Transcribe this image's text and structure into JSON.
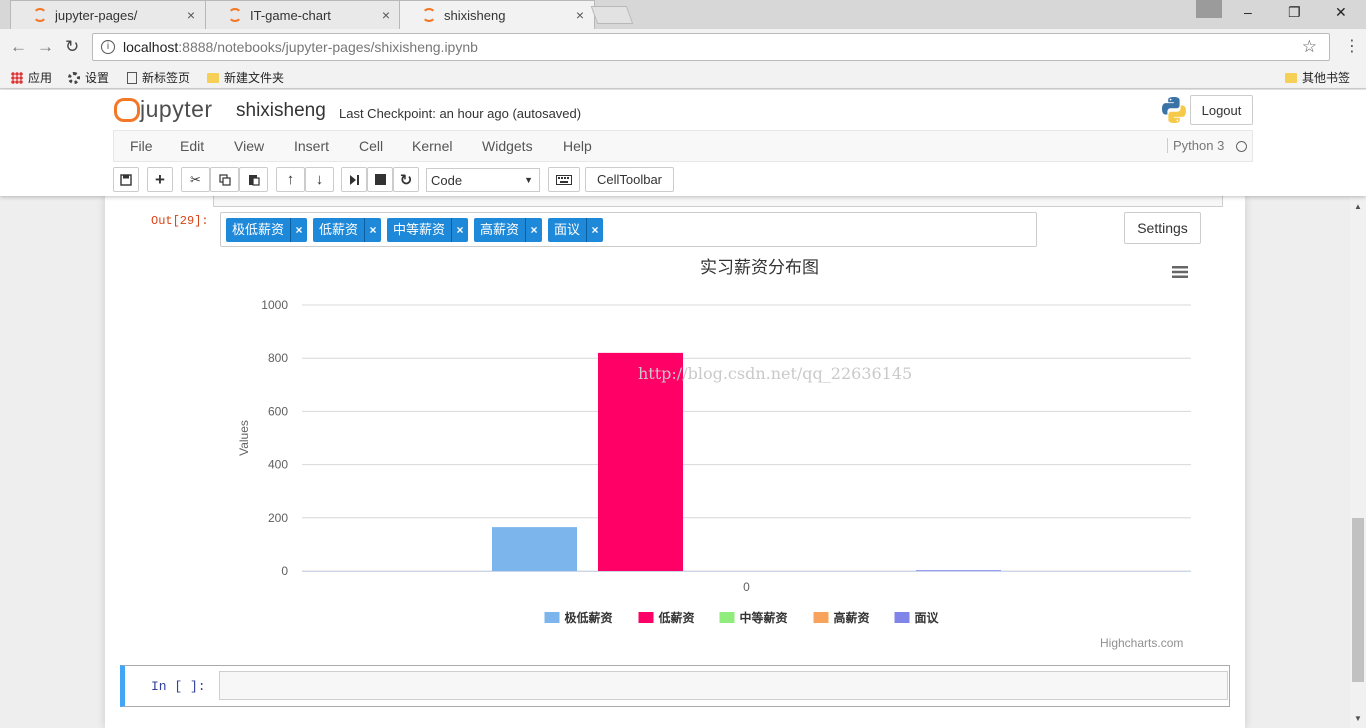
{
  "browser": {
    "tabs": [
      {
        "title": "jupyter-pages/",
        "close": "×"
      },
      {
        "title": "IT-game-chart",
        "close": "×"
      },
      {
        "title": "shixisheng",
        "close": "×"
      }
    ],
    "window_controls": [
      "–",
      "❐",
      "✕"
    ],
    "url_host": "localhost",
    "url_path": ":8888/notebooks/jupyter-pages/shixisheng.ipynb",
    "bookmarks": [
      "应用",
      "设置",
      "新标签页",
      "新建文件夹"
    ],
    "other_bookmarks": "其他书签"
  },
  "jupyter": {
    "logo_text": "jupyter",
    "notebook_name": "shixisheng",
    "checkpoint": "Last Checkpoint: an hour ago (autosaved)",
    "logout": "Logout",
    "menu": [
      "File",
      "Edit",
      "View",
      "Insert",
      "Cell",
      "Kernel",
      "Widgets",
      "Help"
    ],
    "kernel": "Python 3",
    "cell_type": "Code",
    "celltoolbar": "CellToolbar"
  },
  "output": {
    "prompt": "Out[29]:",
    "filters": [
      "极低薪资",
      "低薪资",
      "中等薪资",
      "高薪资",
      "面议"
    ],
    "chip_close": "×",
    "settings": "Settings",
    "credit": "Highcharts.com",
    "watermark": "http://blog.csdn.net/qq_22636145"
  },
  "next_cell": {
    "prompt": "In  [ ]:"
  },
  "chart_data": {
    "type": "bar",
    "title": "实习薪资分布图",
    "categories": [
      "0"
    ],
    "ylabel": "Values",
    "ylim": [
      0,
      1000
    ],
    "yticks": [
      "0",
      "200",
      "400",
      "600",
      "800",
      "1000"
    ],
    "grid": true,
    "legend_position": "bottom-center",
    "series": [
      {
        "name": "极低薪资",
        "values": [
          165
        ],
        "color": "#7cb5ec"
      },
      {
        "name": "低薪资",
        "values": [
          820
        ],
        "color": "#ff0066"
      },
      {
        "name": "中等薪资",
        "values": [
          0
        ],
        "color": "#90ed7d"
      },
      {
        "name": "高薪资",
        "values": [
          0
        ],
        "color": "#f7a35c"
      },
      {
        "name": "面议",
        "values": [
          3
        ],
        "color": "#8085e9"
      }
    ]
  }
}
